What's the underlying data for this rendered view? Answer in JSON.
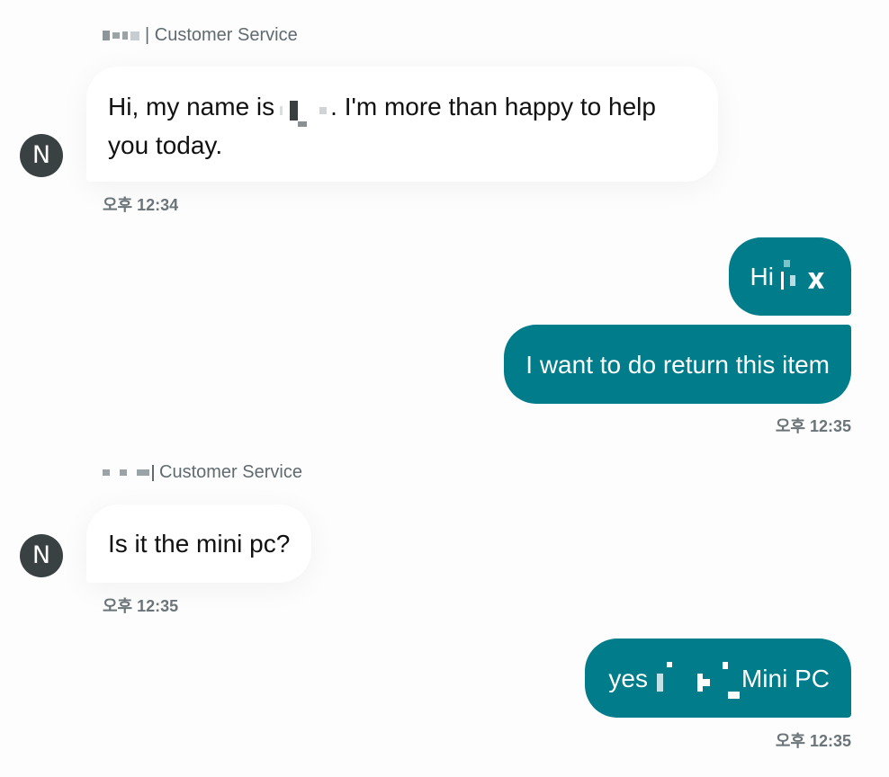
{
  "messages": [
    {
      "role": "agent",
      "sender_suffix": "| Customer Service",
      "avatar": "N",
      "text_before": "Hi, my name is",
      "text_after": ". I'm more than happy to help you today.",
      "time": "오후 12:34"
    },
    {
      "role": "user",
      "text_before": "Hi",
      "time": null
    },
    {
      "role": "user",
      "text": "I want to do return this item",
      "time": "오후 12:35"
    },
    {
      "role": "agent",
      "sender_suffix": "Customer Service",
      "avatar": "N",
      "text": "Is it the mini pc?",
      "time": "오후 12:35"
    },
    {
      "role": "user",
      "text_before": "yes",
      "text_after": "Mini PC",
      "time": "오후 12:35"
    }
  ],
  "colors": {
    "user_bubble": "#007c8a",
    "agent_bubble": "#ffffff",
    "avatar_bg": "#3a4143"
  }
}
